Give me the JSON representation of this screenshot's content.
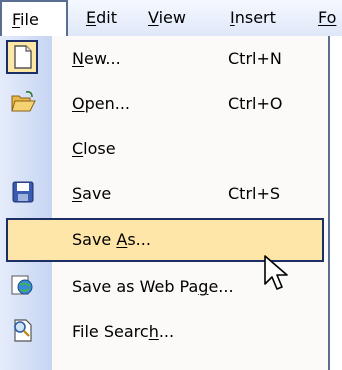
{
  "menubar": {
    "file": {
      "label": "File",
      "accel": "F",
      "rest": "ile"
    },
    "edit": {
      "label": "Edit",
      "accel": "E",
      "rest": "dit"
    },
    "view": {
      "label": "View",
      "accel": "V",
      "rest": "iew"
    },
    "insert": {
      "label": "Insert",
      "accel": "I",
      "rest": "nsert"
    },
    "format": {
      "label": "Fo",
      "accel": "",
      "rest": "Fo"
    }
  },
  "menu": {
    "items": [
      {
        "label": "New...",
        "accel": "N",
        "rest": "ew...",
        "shortcut": "Ctrl+N",
        "icon": "new-document-icon"
      },
      {
        "label": "Open...",
        "accel": "O",
        "rest": "pen...",
        "shortcut": "Ctrl+O",
        "icon": "open-folder-icon"
      },
      {
        "label": "Close",
        "accel": "C",
        "rest": "lose",
        "shortcut": "",
        "icon": ""
      },
      {
        "label": "Save",
        "accel": "S",
        "rest": "ave",
        "shortcut": "Ctrl+S",
        "icon": "save-floppy-icon"
      },
      {
        "label": "Save As...",
        "pre": "Save ",
        "accel": "A",
        "rest": "s...",
        "shortcut": "",
        "icon": ""
      },
      {
        "label": "Save as Web Page...",
        "pre": "Save as Web Pa",
        "accel": "g",
        "rest": "e...",
        "shortcut": "",
        "icon": "web-page-icon"
      },
      {
        "label": "File Search...",
        "pre": "File Searc",
        "accel": "h",
        "rest": "...",
        "shortcut": "",
        "icon": "file-search-icon"
      }
    ],
    "selected_index": 4
  },
  "colors": {
    "highlight_fill": "#fde6a8",
    "highlight_border": "#1b2f66",
    "menu_bg": "#fbfaf8",
    "gutter_light": "#e5ecfb",
    "gutter_dark": "#c6d5f2"
  }
}
